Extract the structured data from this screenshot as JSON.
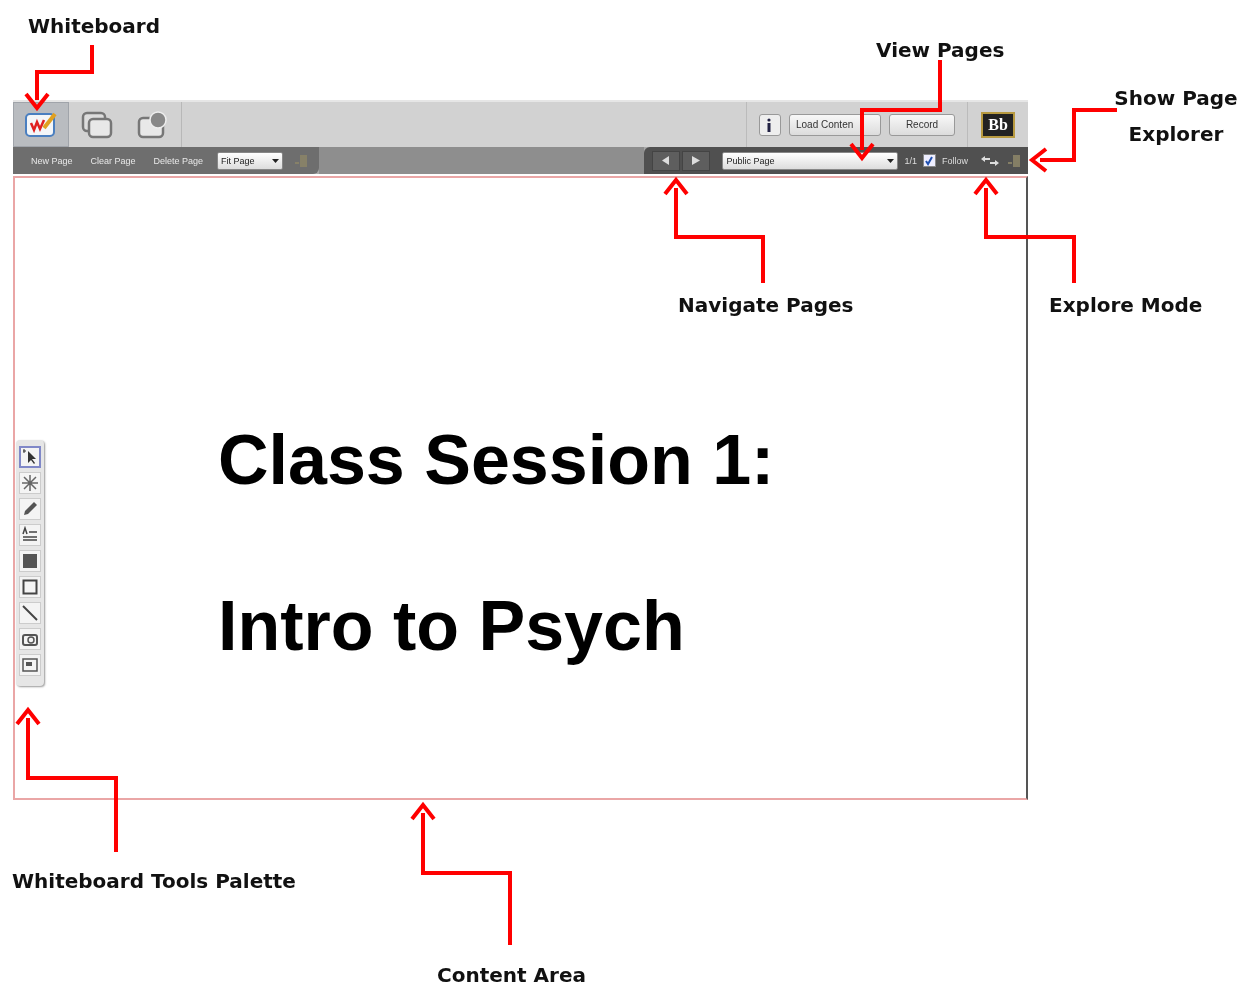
{
  "toolbar": {
    "modes": [
      {
        "kind": "whiteboard",
        "selected": true
      },
      {
        "kind": "windows",
        "selected": false
      },
      {
        "kind": "web",
        "selected": false
      }
    ],
    "buttons": [
      "Load Conten",
      "Record"
    ],
    "logo": "Bb",
    "page_actions": [
      "New Page",
      "Clear Page",
      "Delete Page"
    ],
    "zoom_select": {
      "value": "Fit Page"
    },
    "page_select": {
      "value": "Public Page"
    },
    "page_count": "1/1",
    "follow": {
      "label": "Follow",
      "checked": true
    }
  },
  "tools": [
    {
      "kind": "select",
      "selected": true
    },
    {
      "kind": "laser",
      "selected": false
    },
    {
      "kind": "pencil",
      "selected": false
    },
    {
      "kind": "text",
      "selected": false
    },
    {
      "kind": "filled-rect",
      "selected": false
    },
    {
      "kind": "rect",
      "selected": false
    },
    {
      "kind": "line",
      "selected": false
    },
    {
      "kind": "camera",
      "selected": false
    },
    {
      "kind": "image",
      "selected": false
    }
  ],
  "slide": {
    "lines": [
      "Class Session 1:",
      "Intro to Psych"
    ]
  },
  "annotations": [
    {
      "label": "Whiteboard"
    },
    {
      "label": "View Pages"
    },
    {
      "label": "Show Page Explorer"
    },
    {
      "label": "Navigate Pages"
    },
    {
      "label": "Explore Mode"
    },
    {
      "label": "Whiteboard Tools Palette"
    },
    {
      "label": "Content Area"
    }
  ]
}
